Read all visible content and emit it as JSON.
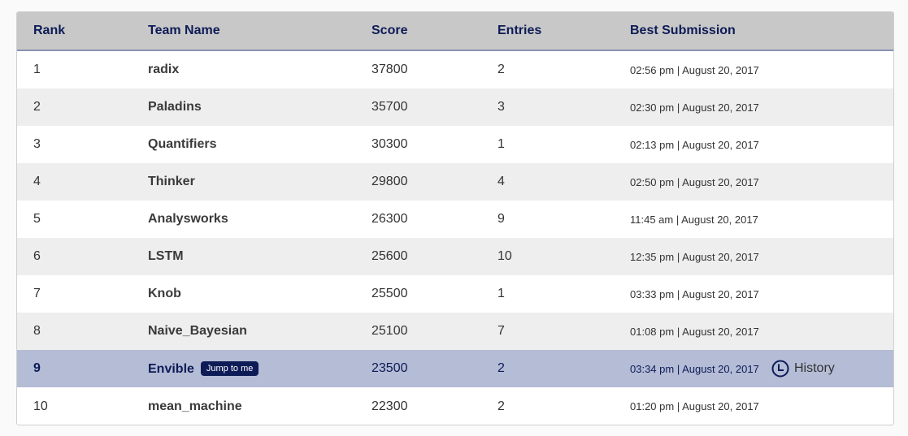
{
  "header": {
    "rank": "Rank",
    "team_name": "Team Name",
    "score": "Score",
    "entries": "Entries",
    "best_submission": "Best Submission"
  },
  "rows": [
    {
      "rank": "1",
      "team": "radix",
      "score": "37800",
      "entries": "2",
      "best": "02:56 pm | August 20, 2017"
    },
    {
      "rank": "2",
      "team": "Paladins",
      "score": "35700",
      "entries": "3",
      "best": "02:30 pm | August 20, 2017"
    },
    {
      "rank": "3",
      "team": "Quantifiers",
      "score": "30300",
      "entries": "1",
      "best": "02:13 pm | August 20, 2017"
    },
    {
      "rank": "4",
      "team": "Thinker",
      "score": "29800",
      "entries": "4",
      "best": "02:50 pm | August 20, 2017"
    },
    {
      "rank": "5",
      "team": "Analysworks",
      "score": "26300",
      "entries": "9",
      "best": "11:45 am | August 20, 2017"
    },
    {
      "rank": "6",
      "team": "LSTM",
      "score": "25600",
      "entries": "10",
      "best": "12:35 pm | August 20, 2017"
    },
    {
      "rank": "7",
      "team": "Knob",
      "score": "25500",
      "entries": "1",
      "best": "03:33 pm | August 20, 2017"
    },
    {
      "rank": "8",
      "team": "Naive_Bayesian",
      "score": "25100",
      "entries": "7",
      "best": "01:08 pm | August 20, 2017"
    },
    {
      "rank": "9",
      "team": "Envible",
      "score": "23500",
      "entries": "2",
      "best": "03:34 pm | August 20, 2017"
    },
    {
      "rank": "10",
      "team": "mean_machine",
      "score": "22300",
      "entries": "2",
      "best": "01:20 pm | August 20, 2017"
    }
  ],
  "current_team": {
    "jump_label": "Jump to me",
    "history_label": "History",
    "history_icon": "clock-icon"
  },
  "colors": {
    "header_bg": "#c8c8c8",
    "header_text": "#0d1b56",
    "highlight_bg": "#b4bcd6",
    "alt_row_bg": "#eeeeee",
    "button_bg": "#0d1b56"
  }
}
